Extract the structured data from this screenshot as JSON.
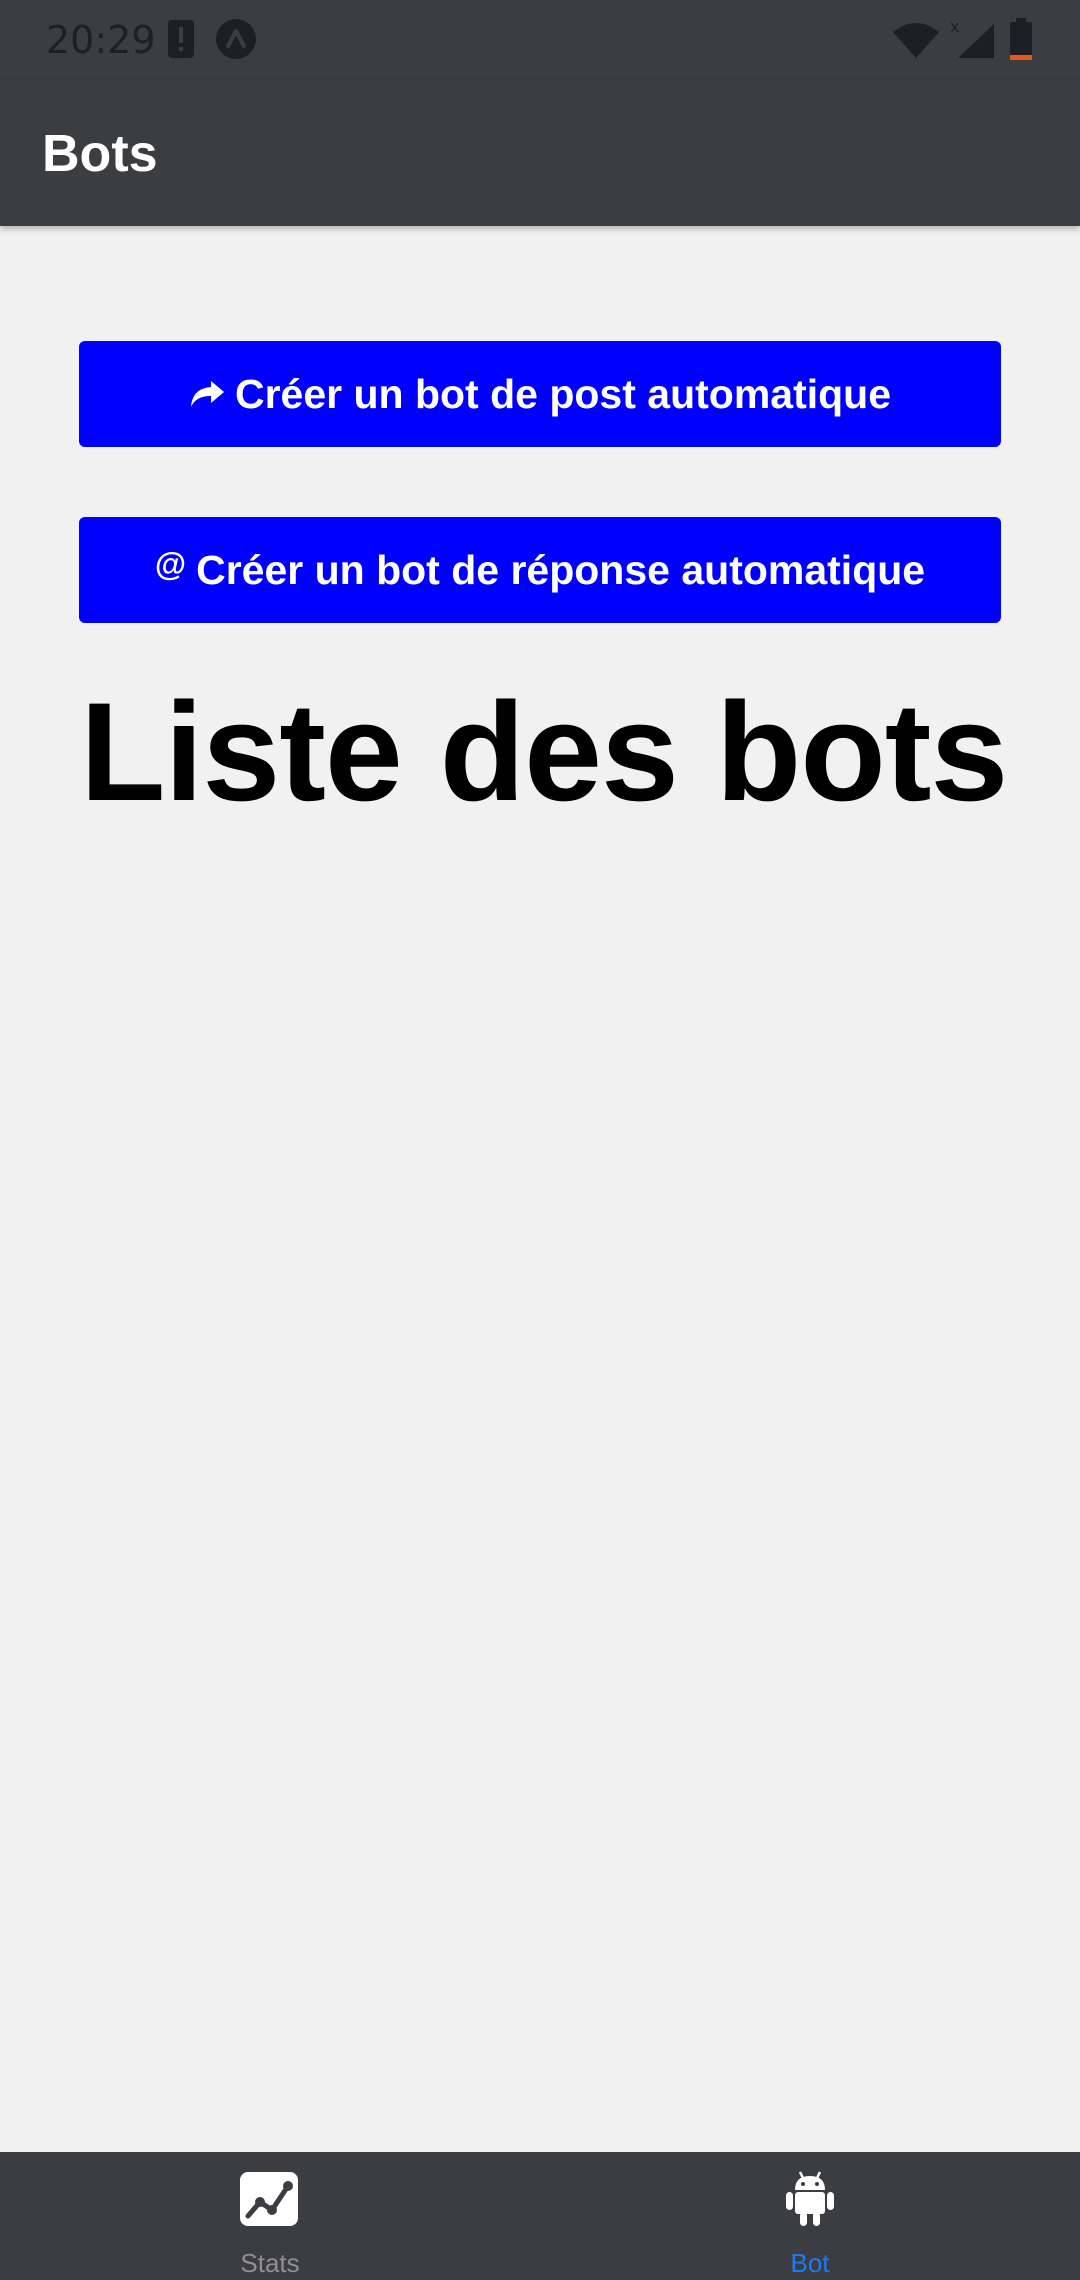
{
  "status_bar": {
    "time": "20:29",
    "icons": [
      "alert-icon",
      "nav-app-icon",
      "wifi-icon",
      "signal-icon",
      "battery-icon"
    ]
  },
  "app_bar": {
    "title": "Bots"
  },
  "actions": {
    "post_bot_label": "Créer un bot de post automatique",
    "post_bot_icon": "share-arrow-icon",
    "reply_bot_label": "Créer un bot de réponse automatique",
    "reply_bot_icon": "at-icon",
    "reply_bot_icon_glyph": "@"
  },
  "main": {
    "list_title": "Liste des bots"
  },
  "bottom_nav": {
    "items": [
      {
        "label": "Stats",
        "icon": "chart-icon",
        "active": false
      },
      {
        "label": "Bot",
        "icon": "android-icon",
        "active": true
      }
    ]
  },
  "colors": {
    "primary_button": "#0000ff",
    "bars": "#3b3d42",
    "background": "#f1f1f1",
    "active_tab": "#1a7cf5",
    "inactive_tab": "#8e8e93",
    "battery_low": "#e8581c"
  }
}
